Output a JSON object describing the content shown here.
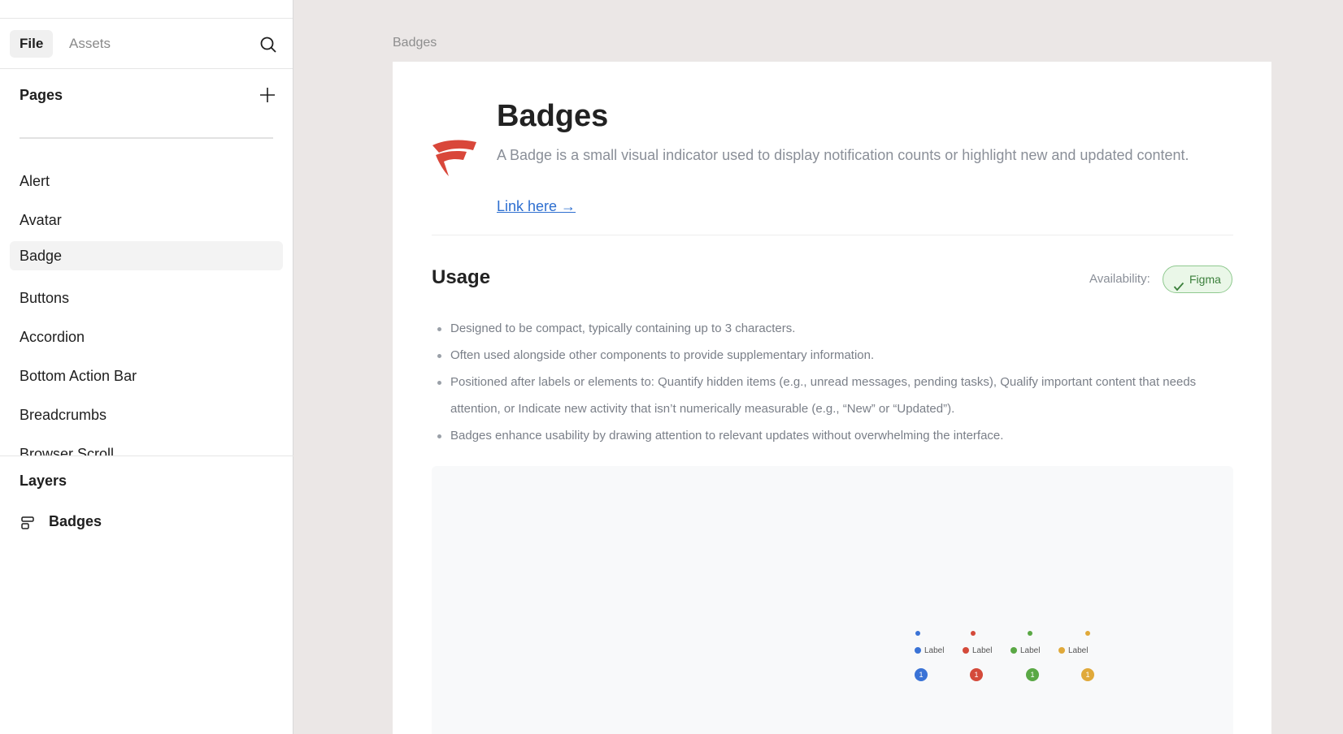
{
  "sidebar": {
    "tabs": {
      "file": "File",
      "assets": "Assets"
    },
    "pages_title": "Pages",
    "pages": [
      {
        "label": "Alert"
      },
      {
        "label": "Avatar"
      },
      {
        "label": "Badge",
        "active": true
      },
      {
        "label": "Buttons"
      },
      {
        "label": "Accordion"
      },
      {
        "label": "Bottom Action Bar"
      },
      {
        "label": "Breadcrumbs"
      },
      {
        "label": "Browser Scroll"
      }
    ],
    "layers_title": "Layers",
    "layers": [
      {
        "label": "Badges",
        "icon": "frame-layout-icon"
      }
    ]
  },
  "canvas": {
    "frame_label": "Badges",
    "title": "Badges",
    "description": "A Badge is a small visual indicator used to display notification counts or highlight new and updated content.",
    "link": "Link here →",
    "usage": {
      "title": "Usage",
      "availability_label": "Availability:",
      "availability_badge": "Figma",
      "bullets": [
        "Designed to be compact, typically containing up to 3 characters.",
        "Often used alongside other components to provide supplementary information.",
        "Positioned after labels or elements to: Quantify hidden items (e.g., unread messages, pending tasks), Qualify important content that needs attention, or Indicate new activity that isn’t numerically measurable (e.g., “New” or “Updated”).",
        "Badges enhance usability by drawing attention to relevant updates without overwhelming the interface."
      ]
    },
    "preview": {
      "label_text": "Label",
      "count_text": "1",
      "colors": [
        "#3a73d6",
        "#d44a3a",
        "#5aa845",
        "#e0a93a"
      ]
    }
  },
  "colors": {
    "brand_logo": "#d9473a",
    "link": "#2e6fd0",
    "canvas_bg": "#ebe7e6"
  }
}
